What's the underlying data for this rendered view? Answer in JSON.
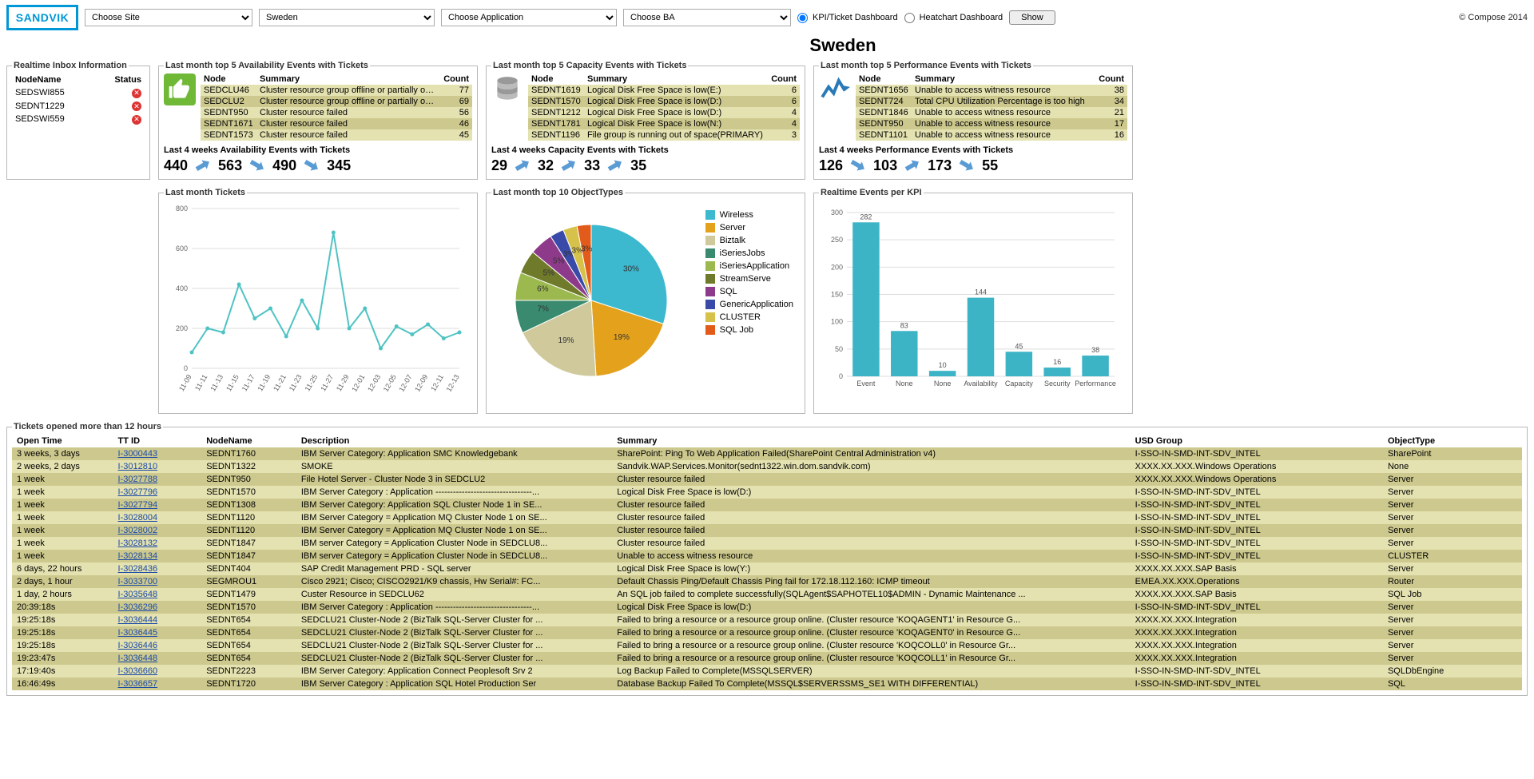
{
  "copyright": "© Compose 2014",
  "topbar": {
    "site": "Choose Site",
    "country": "Sweden",
    "app": "Choose Application",
    "ba": "Choose BA",
    "radio1": "KPI/Ticket Dashboard",
    "radio2": "Heatchart Dashboard",
    "show": "Show"
  },
  "title": "Sweden",
  "inbox": {
    "legend": "Realtime Inbox Information",
    "cols": [
      "NodeName",
      "Status"
    ],
    "rows": [
      {
        "node": "SEDSWI855"
      },
      {
        "node": "SEDNT1229"
      },
      {
        "node": "SEDSWI559"
      }
    ]
  },
  "panels": [
    {
      "legend": "Last month top 5 Availability Events with Tickets",
      "icon": "thumb",
      "cols": [
        "Node",
        "Summary",
        "Count"
      ],
      "rows": [
        {
          "node": "SEDCLU46",
          "summary": "Cluster resource group offline or partially online(Cluster Group...",
          "count": "77"
        },
        {
          "node": "SEDCLU2",
          "summary": "Cluster resource group offline or partially online(Cluster Group...",
          "count": "69"
        },
        {
          "node": "SEDNT950",
          "summary": "Cluster resource failed",
          "count": "56"
        },
        {
          "node": "SEDNT1671",
          "summary": "Cluster resource failed",
          "count": "46"
        },
        {
          "node": "SEDNT1573",
          "summary": "Cluster resource failed",
          "count": "45"
        }
      ],
      "trend_label": "Last 4 weeks Availability Events with Tickets",
      "trend": [
        "440",
        "563",
        "490",
        "345"
      ],
      "trend_dir": [
        "up",
        "down",
        "down"
      ]
    },
    {
      "legend": "Last month top 5 Capacity Events with Tickets",
      "icon": "db",
      "cols": [
        "Node",
        "Summary",
        "Count"
      ],
      "rows": [
        {
          "node": "SEDNT1619",
          "summary": "Logical Disk Free Space is low(E:)",
          "count": "6"
        },
        {
          "node": "SEDNT1570",
          "summary": "Logical Disk Free Space is low(D:)",
          "count": "6"
        },
        {
          "node": "SEDNT1212",
          "summary": "Logical Disk Free Space is low(D:)",
          "count": "4"
        },
        {
          "node": "SEDNT1781",
          "summary": "Logical Disk Free Space is low(N:)",
          "count": "4"
        },
        {
          "node": "SEDNT1196",
          "summary": "File group is running out of space(PRIMARY)",
          "count": "3"
        }
      ],
      "trend_label": "Last 4 weeks Capacity Events with Tickets",
      "trend": [
        "29",
        "32",
        "33",
        "35"
      ],
      "trend_dir": [
        "up",
        "up",
        "up"
      ]
    },
    {
      "legend": "Last month top 5 Performance Events with Tickets",
      "icon": "perf",
      "cols": [
        "Node",
        "Summary",
        "Count"
      ],
      "rows": [
        {
          "node": "SEDNT1656",
          "summary": "Unable to access witness resource",
          "count": "38"
        },
        {
          "node": "SEDNT724",
          "summary": "Total CPU Utilization Percentage is too high",
          "count": "34"
        },
        {
          "node": "SEDNT1846",
          "summary": "Unable to access witness resource",
          "count": "21"
        },
        {
          "node": "SEDNT950",
          "summary": "Unable to access witness resource",
          "count": "17"
        },
        {
          "node": "SEDNT1101",
          "summary": "Unable to access witness resource",
          "count": "16"
        }
      ],
      "trend_label": "Last 4 weeks Performance Events with Tickets",
      "trend": [
        "126",
        "103",
        "173",
        "55"
      ],
      "trend_dir": [
        "down",
        "up",
        "down"
      ]
    }
  ],
  "charts": {
    "line": {
      "legend": "Last month Tickets"
    },
    "pie": {
      "legend": "Last month top 10 ObjectTypes"
    },
    "bar": {
      "legend": "Realtime Events per KPI"
    }
  },
  "chart_data": [
    {
      "type": "line",
      "title": "Last month Tickets",
      "xlabel": "",
      "ylabel": "",
      "ylim": [
        0,
        800
      ],
      "categories": [
        "11-09",
        "11-11",
        "11-13",
        "11-15",
        "11-17",
        "11-19",
        "11-21",
        "11-23",
        "11-25",
        "11-27",
        "11-29",
        "12-01",
        "12-03",
        "12-05",
        "12-07",
        "12-09",
        "12-11",
        "12-13"
      ],
      "values": [
        80,
        200,
        180,
        420,
        250,
        300,
        160,
        340,
        200,
        680,
        200,
        300,
        100,
        210,
        170,
        220,
        150,
        180
      ]
    },
    {
      "type": "pie",
      "title": "Last month top 10 ObjectTypes",
      "series": [
        {
          "name": "Wireless",
          "value": 30,
          "color": "#3cb9cf"
        },
        {
          "name": "Server",
          "value": 19,
          "color": "#e4a11b"
        },
        {
          "name": "Biztalk",
          "value": 19,
          "color": "#cfc99b"
        },
        {
          "name": "iSeriesJobs",
          "value": 7,
          "color": "#3a8a6f"
        },
        {
          "name": "iSeriesApplication",
          "value": 6,
          "color": "#9cb94f"
        },
        {
          "name": "StreamServe",
          "value": 5,
          "color": "#6f7a2a"
        },
        {
          "name": "SQL",
          "value": 5,
          "color": "#8e3a8a"
        },
        {
          "name": "GenericApplication",
          "value": 3,
          "color": "#3a4aa8"
        },
        {
          "name": "CLUSTER",
          "value": 3,
          "color": "#d6c24a"
        },
        {
          "name": "SQL Job",
          "value": 3,
          "color": "#e25b1b"
        }
      ]
    },
    {
      "type": "bar",
      "title": "Realtime Events per KPI",
      "ylim": [
        0,
        300
      ],
      "categories": [
        "Event",
        "None",
        "None",
        "Availability",
        "Capacity",
        "Security",
        "Performance"
      ],
      "values": [
        282,
        83,
        10,
        144,
        45,
        16,
        38
      ]
    }
  ],
  "tickets": {
    "legend": "Tickets opened more than 12 hours",
    "cols": [
      "Open Time",
      "TT ID",
      "NodeName",
      "Description",
      "Summary",
      "USD Group",
      "ObjectType"
    ],
    "rows": [
      {
        "open": "3 weeks, 3 days",
        "tt": "I-3000443",
        "node": "SEDNT1760",
        "desc": "IBM Server Category: Application SMC Knowledgebank",
        "sum": "SharePoint: Ping To Web Application Failed(SharePoint Central Administration v4)",
        "grp": "I-SSO-IN-SMD-INT-SDV_INTEL",
        "obj": "SharePoint"
      },
      {
        "open": "2 weeks, 2 days",
        "tt": "I-3012810",
        "node": "SEDNT1322",
        "desc": "SMOKE",
        "sum": "Sandvik.WAP.Services.Monitor(sednt1322.win.dom.sandvik.com)",
        "grp": "XXXX.XX.XXX.Windows Operations",
        "obj": "None"
      },
      {
        "open": "1 week",
        "tt": "I-3027788",
        "node": "SEDNT950",
        "desc": "File Hotel Server - Cluster Node 3 in SEDCLU2",
        "sum": "Cluster resource failed",
        "grp": "XXXX.XX.XXX.Windows Operations",
        "obj": "Server"
      },
      {
        "open": "1 week",
        "tt": "I-3027796",
        "node": "SEDNT1570",
        "desc": "IBM Server Category : Application ---------------------------------...",
        "sum": "Logical Disk Free Space is low(D:)",
        "grp": "I-SSO-IN-SMD-INT-SDV_INTEL",
        "obj": "Server"
      },
      {
        "open": "1 week",
        "tt": "I-3027794",
        "node": "SEDNT1308",
        "desc": "IBM Server Category: Application SQL Cluster Node 1 in SE...",
        "sum": "Cluster resource failed",
        "grp": "I-SSO-IN-SMD-INT-SDV_INTEL",
        "obj": "Server"
      },
      {
        "open": "1 week",
        "tt": "I-3028004",
        "node": "SEDNT1120",
        "desc": "IBM Server Category = Application MQ Cluster Node 1 on SE...",
        "sum": "Cluster resource failed",
        "grp": "I-SSO-IN-SMD-INT-SDV_INTEL",
        "obj": "Server"
      },
      {
        "open": "1 week",
        "tt": "I-3028002",
        "node": "SEDNT1120",
        "desc": "IBM Server Category = Application MQ Cluster Node 1 on SE...",
        "sum": "Cluster resource failed",
        "grp": "I-SSO-IN-SMD-INT-SDV_INTEL",
        "obj": "Server"
      },
      {
        "open": "1 week",
        "tt": "I-3028132",
        "node": "SEDNT1847",
        "desc": "IBM server Category = Application Cluster Node in SEDCLU8...",
        "sum": "Cluster resource failed",
        "grp": "I-SSO-IN-SMD-INT-SDV_INTEL",
        "obj": "Server"
      },
      {
        "open": "1 week",
        "tt": "I-3028134",
        "node": "SEDNT1847",
        "desc": "IBM server Category = Application Cluster Node in SEDCLU8...",
        "sum": "Unable to access witness resource",
        "grp": "I-SSO-IN-SMD-INT-SDV_INTEL",
        "obj": "CLUSTER"
      },
      {
        "open": "6 days, 22 hours",
        "tt": "I-3028436",
        "node": "SEDNT404",
        "desc": "SAP Credit Management PRD - SQL server",
        "sum": "Logical Disk Free Space is low(Y:)",
        "grp": "XXXX.XX.XXX.SAP Basis",
        "obj": "Server"
      },
      {
        "open": "2 days, 1 hour",
        "tt": "I-3033700",
        "node": "SEGMROU1",
        "desc": "Cisco 2921; Cisco; CISCO2921/K9 chassis, Hw Serial#: FC...",
        "sum": "Default Chassis Ping/Default Chassis Ping fail for 172.18.112.160: ICMP timeout",
        "grp": "EMEA.XX.XXX.Operations",
        "obj": "Router"
      },
      {
        "open": "1 day, 2 hours",
        "tt": "I-3035648",
        "node": "SEDNT1479",
        "desc": "Custer Resource in SEDCLU62",
        "sum": "An SQL job failed to complete successfully(SQLAgent$SAPHOTEL10$ADMIN - Dynamic Maintenance ...",
        "grp": "XXXX.XX.XXX.SAP Basis",
        "obj": "SQL Job"
      },
      {
        "open": "20:39:18s",
        "tt": "I-3036296",
        "node": "SEDNT1570",
        "desc": "IBM Server Category : Application ---------------------------------...",
        "sum": "Logical Disk Free Space is low(D:)",
        "grp": "I-SSO-IN-SMD-INT-SDV_INTEL",
        "obj": "Server"
      },
      {
        "open": "19:25:18s",
        "tt": "I-3036444",
        "node": "SEDNT654",
        "desc": "SEDCLU21 Cluster-Node 2 (BizTalk SQL-Server Cluster for ...",
        "sum": "Failed to bring a resource or a resource group online. (Cluster resource 'KOQAGENT1' in Resource G...",
        "grp": "XXXX.XX.XXX.Integration",
        "obj": "Server"
      },
      {
        "open": "19:25:18s",
        "tt": "I-3036445",
        "node": "SEDNT654",
        "desc": "SEDCLU21 Cluster-Node 2 (BizTalk SQL-Server Cluster for ...",
        "sum": "Failed to bring a resource or a resource group online. (Cluster resource 'KOQAGENT0' in Resource G...",
        "grp": "XXXX.XX.XXX.Integration",
        "obj": "Server"
      },
      {
        "open": "19:25:18s",
        "tt": "I-3036446",
        "node": "SEDNT654",
        "desc": "SEDCLU21 Cluster-Node 2 (BizTalk SQL-Server Cluster for ...",
        "sum": "Failed to bring a resource or a resource group online. (Cluster resource 'KOQCOLL0' in Resource Gr...",
        "grp": "XXXX.XX.XXX.Integration",
        "obj": "Server"
      },
      {
        "open": "19:23:47s",
        "tt": "I-3036448",
        "node": "SEDNT654",
        "desc": "SEDCLU21 Cluster-Node 2 (BizTalk SQL-Server Cluster for ...",
        "sum": "Failed to bring a resource or a resource group online. (Cluster resource 'KOQCOLL1' in Resource Gr...",
        "grp": "XXXX.XX.XXX.Integration",
        "obj": "Server"
      },
      {
        "open": "17:19:40s",
        "tt": "I-3036660",
        "node": "SEDNT2223",
        "desc": "IBM Server Category: Application Connect Peoplesoft Srv 2",
        "sum": "Log Backup Failed to Complete(MSSQLSERVER)",
        "grp": "I-SSO-IN-SMD-INT-SDV_INTEL",
        "obj": "SQLDbEngine"
      },
      {
        "open": "16:46:49s",
        "tt": "I-3036657",
        "node": "SEDNT1720",
        "desc": "IBM Server Category : Application SQL Hotel Production Ser",
        "sum": "Database Backup Failed To Complete(MSSQL$SERVERSSMS_SE1 WITH DIFFERENTIAL)",
        "grp": "I-SSO-IN-SMD-INT-SDV_INTEL",
        "obj": "SQL"
      }
    ]
  }
}
